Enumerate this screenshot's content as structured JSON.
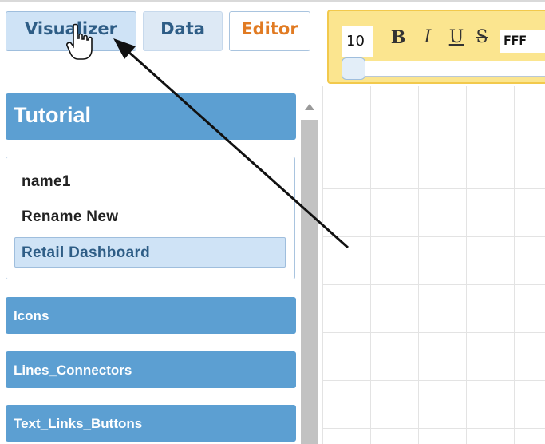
{
  "tabs": {
    "visualizer": "Visualizer",
    "data": "Data",
    "editor": "Editor"
  },
  "toolbar": {
    "font_size": "10",
    "bold": "B",
    "italic": "I",
    "underline": "U",
    "strike": "S",
    "color_value": "FFF"
  },
  "sidebar": {
    "tutorial": {
      "title": "Tutorial",
      "items": [
        "name1",
        "Rename New",
        "Retail Dashboard"
      ],
      "selected": "Retail Dashboard"
    },
    "sections": [
      "Icons",
      "Lines_Connectors",
      "Text_Links_Buttons"
    ]
  },
  "icons": {
    "cursor": "hand-pointer-icon",
    "annotation": "arrow-icon",
    "scroll_up": "triangle-up-icon"
  },
  "colors": {
    "header_blue": "#5c9fd2",
    "selected_bg": "#cfe3f6",
    "editor_orange": "#e17b23",
    "toolbar_yellow": "#fbe58f"
  }
}
